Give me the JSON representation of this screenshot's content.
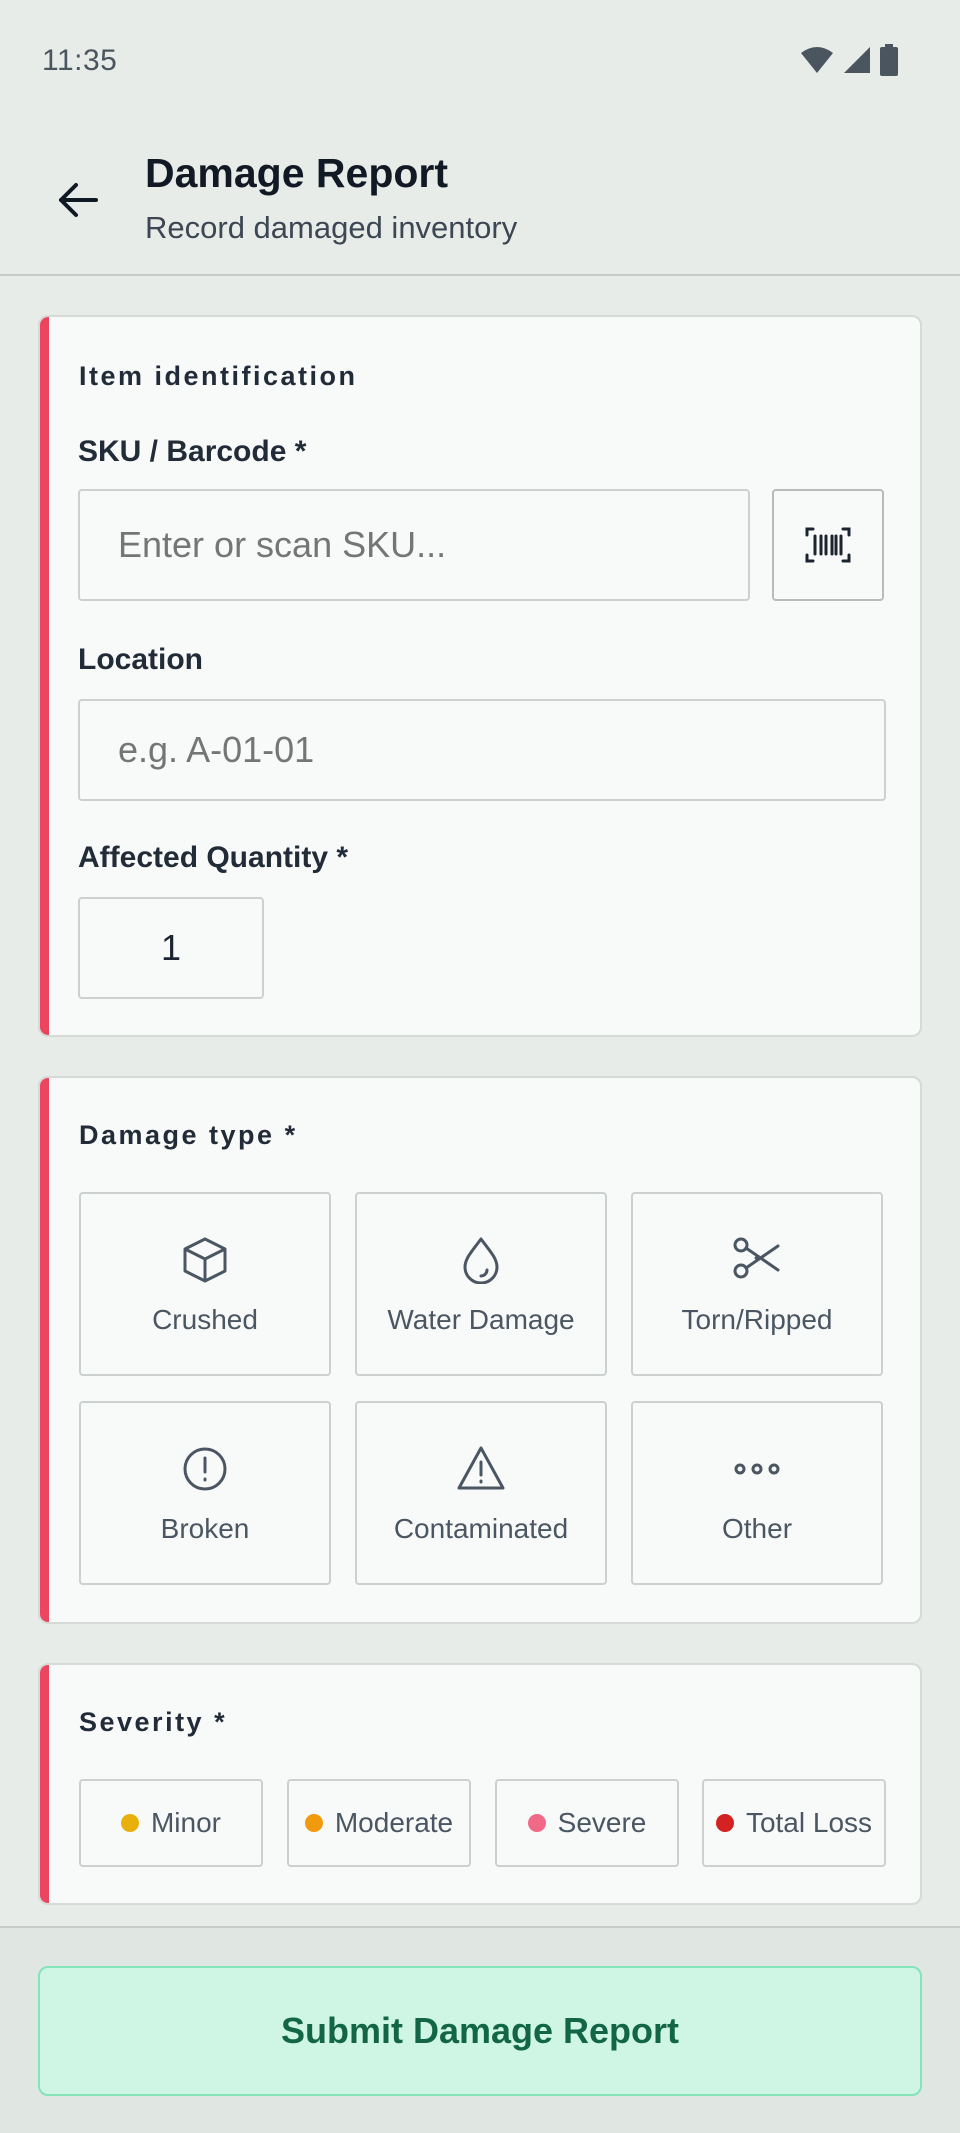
{
  "status_bar": {
    "time": "11:35"
  },
  "header": {
    "title": "Damage Report",
    "subtitle": "Record damaged inventory"
  },
  "item_identification": {
    "section_title": "Item identification",
    "sku": {
      "label": "SKU / Barcode *",
      "placeholder": "Enter or scan SKU...",
      "value": ""
    },
    "location": {
      "label": "Location",
      "placeholder": "e.g. A-01-01",
      "value": ""
    },
    "quantity": {
      "label": "Affected Quantity *",
      "value": "1"
    }
  },
  "damage_type": {
    "section_title": "Damage type *",
    "options": [
      {
        "label": "Crushed",
        "icon": "box-icon"
      },
      {
        "label": "Water Damage",
        "icon": "droplet-icon"
      },
      {
        "label": "Torn/Ripped",
        "icon": "scissors-icon"
      },
      {
        "label": "Broken",
        "icon": "alert-circle-icon"
      },
      {
        "label": "Contaminated",
        "icon": "warning-triangle-icon"
      },
      {
        "label": "Other",
        "icon": "more-horizontal-icon"
      }
    ]
  },
  "severity": {
    "section_title": "Severity *",
    "options": [
      {
        "label": "Minor",
        "color": "#e8b00c"
      },
      {
        "label": "Moderate",
        "color": "#f29a0e"
      },
      {
        "label": "Severe",
        "color": "#f06a87"
      },
      {
        "label": "Total Loss",
        "color": "#d42222"
      }
    ]
  },
  "submit_label": "Submit Damage Report",
  "colors": {
    "accent_bar": "#ec4560",
    "submit_bg": "#cff6e5",
    "submit_text": "#126545"
  }
}
